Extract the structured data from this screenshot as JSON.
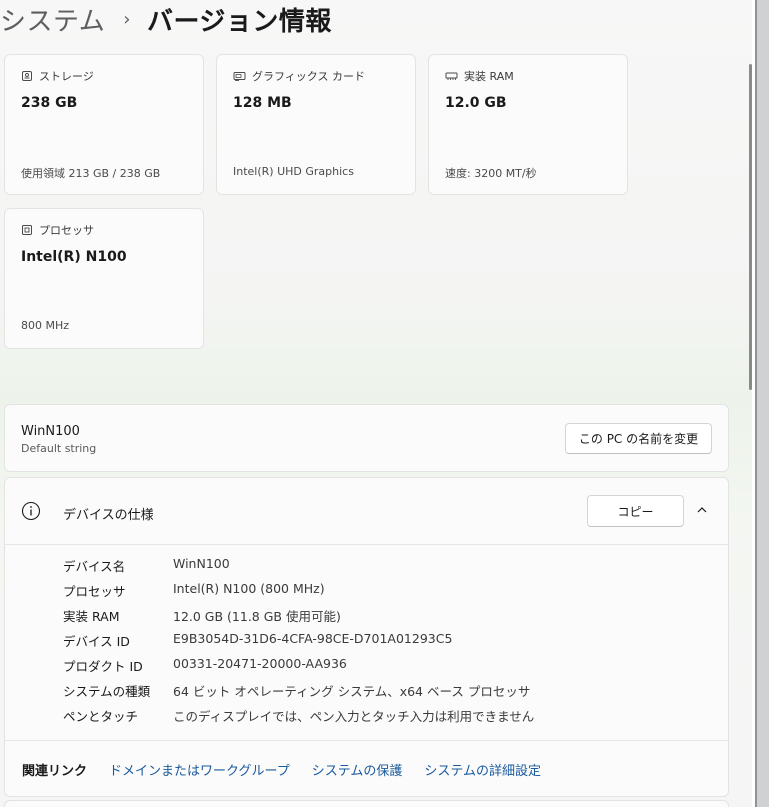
{
  "breadcrumb": {
    "parent": "システム",
    "separator": "›",
    "current": "バージョン情報"
  },
  "cards": [
    {
      "icon": "storage-icon",
      "label": "ストレージ",
      "value": "238 GB",
      "sub": "使用領域 213 GB / 238 GB"
    },
    {
      "icon": "graphics-card-icon",
      "label": "グラフィックス カード",
      "value": "128 MB",
      "sub": "Intel(R) UHD Graphics"
    },
    {
      "icon": "memory-icon",
      "label": "実装 RAM",
      "value": "12.0 GB",
      "sub": "速度: 3200 MT/秒"
    },
    {
      "icon": "processor-icon",
      "label": "プロセッサ",
      "value": "Intel(R) N100",
      "sub": "800 MHz"
    }
  ],
  "device": {
    "name": "WinN100",
    "subtitle": "Default string",
    "rename_label": "この PC の名前を変更"
  },
  "specs": {
    "title": "デバイスの仕様",
    "copy_label": "コピー",
    "rows": [
      {
        "key": "デバイス名",
        "value": "WinN100"
      },
      {
        "key": "プロセッサ",
        "value": "Intel(R) N100 (800 MHz)"
      },
      {
        "key": "実装 RAM",
        "value": "12.0 GB (11.8 GB 使用可能)"
      },
      {
        "key": "デバイス ID",
        "value": "E9B3054D-31D6-4CFA-98CE-D701A01293C5"
      },
      {
        "key": "プロダクト ID",
        "value": "00331-20471-20000-AA936"
      },
      {
        "key": "システムの種類",
        "value": "64 ビット オペレーティング システム、x64 ベース プロセッサ"
      },
      {
        "key": "ペンとタッチ",
        "value": "このディスプレイでは、ペン入力とタッチ入力は利用できません"
      }
    ]
  },
  "related": {
    "label": "関連リンク",
    "links": [
      "ドメインまたはワークグループ",
      "システムの保護",
      "システムの詳細設定"
    ]
  },
  "colors": {
    "link": "#1a5a9e",
    "text": "#1a1a1a",
    "muted": "#5e5e5e"
  }
}
